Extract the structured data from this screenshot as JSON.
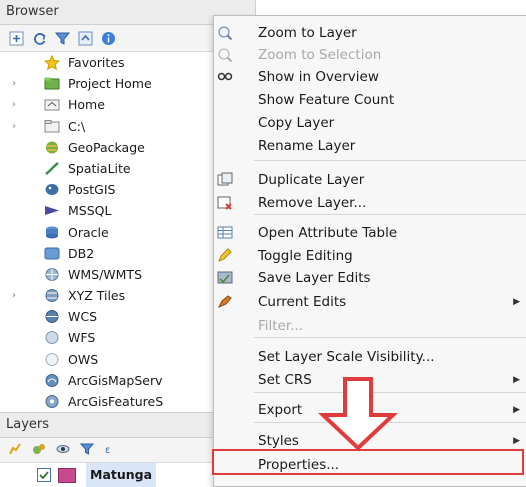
{
  "browser": {
    "title": "Browser",
    "toolbar": [
      "add-icon",
      "refresh-icon",
      "filter-icon",
      "collapse-icon",
      "info-icon"
    ],
    "items": [
      {
        "label": "Favorites",
        "icon": "star-icon",
        "expandable": false
      },
      {
        "label": "Project Home",
        "icon": "project-folder-icon",
        "expandable": true
      },
      {
        "label": "Home",
        "icon": "home-folder-icon",
        "expandable": true
      },
      {
        "label": "C:\\",
        "icon": "drive-folder-icon",
        "expandable": true
      },
      {
        "label": "GeoPackage",
        "icon": "geopackage-icon",
        "expandable": false
      },
      {
        "label": "SpatiaLite",
        "icon": "spatialite-icon",
        "expandable": false
      },
      {
        "label": "PostGIS",
        "icon": "postgis-icon",
        "expandable": false
      },
      {
        "label": "MSSQL",
        "icon": "mssql-icon",
        "expandable": false
      },
      {
        "label": "Oracle",
        "icon": "oracle-icon",
        "expandable": false
      },
      {
        "label": "DB2",
        "icon": "db2-icon",
        "expandable": false
      },
      {
        "label": "WMS/WMTS",
        "icon": "wms-icon",
        "expandable": false
      },
      {
        "label": "XYZ Tiles",
        "icon": "xyz-tiles-icon",
        "expandable": true
      },
      {
        "label": "WCS",
        "icon": "wcs-icon",
        "expandable": false
      },
      {
        "label": "WFS",
        "icon": "wfs-icon",
        "expandable": false
      },
      {
        "label": "OWS",
        "icon": "ows-icon",
        "expandable": false
      },
      {
        "label": "ArcGisMapServ",
        "icon": "arcgis-map-icon",
        "expandable": false
      },
      {
        "label": "ArcGisFeatureS",
        "icon": "arcgis-feature-icon",
        "expandable": false
      }
    ]
  },
  "layers": {
    "title": "Layers",
    "toolbar": [
      "style-icon",
      "add-group-icon",
      "visibility-icon",
      "filter-icon",
      "expression-icon"
    ],
    "layer_name": "Matunga",
    "layer_checked": true
  },
  "context_menu": {
    "items": [
      {
        "label": "Zoom to Layer",
        "icon": "zoom-layer-icon",
        "disabled": false,
        "submenu": false
      },
      {
        "label": "Zoom to Selection",
        "icon": "zoom-selection-icon",
        "disabled": true,
        "submenu": false
      },
      {
        "label": "Show in Overview",
        "icon": "overview-icon",
        "disabled": false,
        "submenu": false
      },
      {
        "label": "Show Feature Count",
        "icon": "",
        "disabled": false,
        "submenu": false
      },
      {
        "label": "Copy Layer",
        "icon": "",
        "disabled": false,
        "submenu": false
      },
      {
        "label": "Rename Layer",
        "icon": "",
        "disabled": false,
        "submenu": false
      },
      {
        "label": "Duplicate Layer",
        "icon": "duplicate-icon",
        "disabled": false,
        "submenu": false
      },
      {
        "label": "Remove Layer...",
        "icon": "remove-icon",
        "disabled": false,
        "submenu": false
      },
      {
        "label": "Open Attribute Table",
        "icon": "table-icon",
        "disabled": false,
        "submenu": false
      },
      {
        "label": "Toggle Editing",
        "icon": "pencil-icon",
        "disabled": false,
        "submenu": false
      },
      {
        "label": "Save Layer Edits",
        "icon": "save-edits-icon",
        "disabled": false,
        "submenu": false
      },
      {
        "label": "Current Edits",
        "icon": "current-edits-icon",
        "disabled": false,
        "submenu": true
      },
      {
        "label": "Filter...",
        "icon": "",
        "disabled": true,
        "submenu": false
      },
      {
        "label": "Set Layer Scale Visibility...",
        "icon": "",
        "disabled": false,
        "submenu": false
      },
      {
        "label": "Set CRS",
        "icon": "",
        "disabled": false,
        "submenu": true
      },
      {
        "label": "Export",
        "icon": "",
        "disabled": false,
        "submenu": true
      },
      {
        "label": "Styles",
        "icon": "",
        "disabled": false,
        "submenu": true
      },
      {
        "label": "Properties...",
        "icon": "",
        "disabled": false,
        "submenu": false
      }
    ]
  },
  "colors": {
    "annotation_red": "#e23b3b",
    "selection_blue": "#d9e6f7",
    "disabled_text": "#a8a8a8"
  }
}
